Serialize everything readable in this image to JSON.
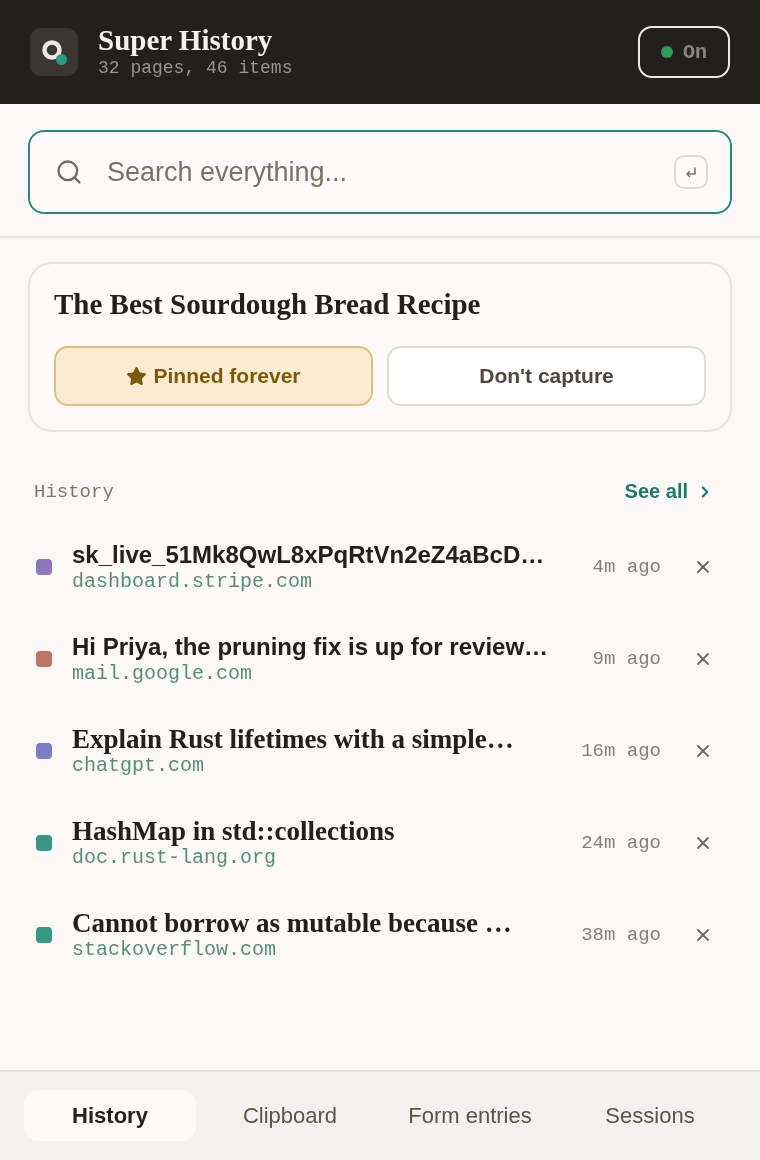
{
  "header": {
    "title": "Super History",
    "subtitle": "32 pages, 46 items",
    "toggle": {
      "label": "On",
      "on": true
    }
  },
  "search": {
    "placeholder": "Search everything..."
  },
  "current_page": {
    "title": "The Best Sourdough Bread Recipe",
    "actions": [
      {
        "kind": "pin",
        "label": "Pinned forever",
        "selected": true
      },
      {
        "kind": "exclude",
        "label": "Don't capture",
        "selected": false
      }
    ]
  },
  "history": {
    "heading": "History",
    "see_all": "See all",
    "items": [
      {
        "kind": "snippet",
        "title": "sk_live_51Mk8QwL8xPqRtVn2eZ4aBcD…",
        "domain": "dashboard.stripe.com",
        "time": "4m ago",
        "color": "#8b78bd"
      },
      {
        "kind": "snippet",
        "title": "Hi Priya, the pruning fix is up for review…",
        "domain": "mail.google.com",
        "time": "9m ago",
        "color": "#bd7566"
      },
      {
        "kind": "page",
        "title": "Explain Rust lifetimes with a simple…",
        "domain": "chatgpt.com",
        "time": "16m ago",
        "color": "#7e7fc3"
      },
      {
        "kind": "page",
        "title": "HashMap in std::collections",
        "domain": "doc.rust-lang.org",
        "time": "24m ago",
        "color": "#369883"
      },
      {
        "kind": "page",
        "title": "Cannot borrow as mutable because …",
        "domain": "stackoverflow.com",
        "time": "38m ago",
        "color": "#369883"
      }
    ]
  },
  "tabs": [
    {
      "label": "History",
      "selected": true
    },
    {
      "label": "Clipboard",
      "selected": false
    },
    {
      "label": "Form entries",
      "selected": false
    },
    {
      "label": "Sessions",
      "selected": false
    }
  ]
}
